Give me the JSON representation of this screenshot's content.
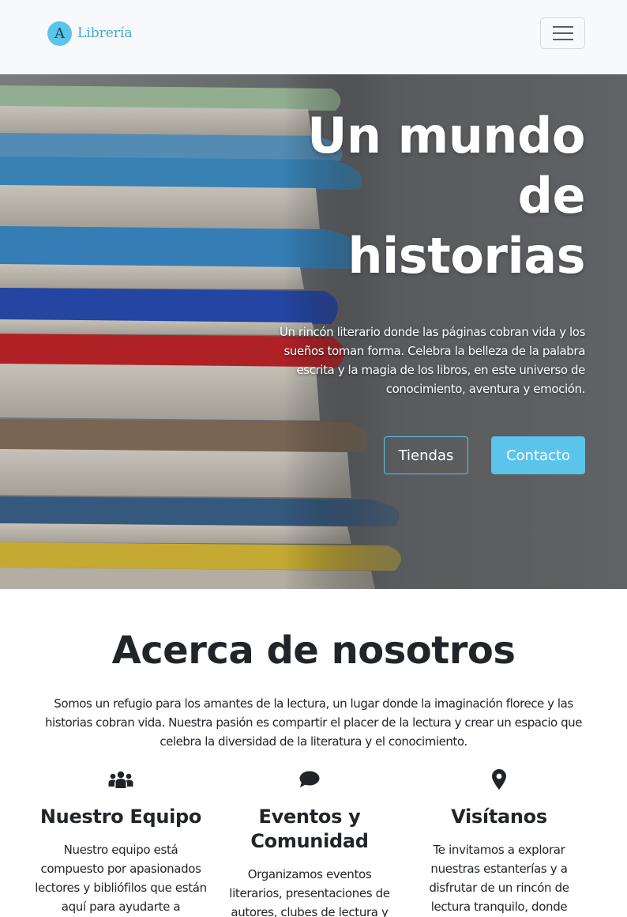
{
  "navbar": {
    "logo_letter": "A",
    "brand_text": "Librería",
    "brand_color": "#45a9cf",
    "menu_icon": "hamburger-icon"
  },
  "hero": {
    "title_line1": "Un mundo",
    "title_line2": "de",
    "title_line3": "historias",
    "subtitle": "Un rincón literario donde las páginas cobran vida y los sueños toman forma. Celebra la belleza de la palabra escrita y la magia de los libros, en este universo de conocimiento, aventura y emoción.",
    "buttons": {
      "stores_label": "Tiendas",
      "contact_label": "Contacto"
    },
    "accent_color": "#5bc4ea"
  },
  "about": {
    "title": "Acerca de nosotros",
    "text": "Somos un refugio para los amantes de la lectura, un lugar donde la imaginación florece y las historias cobran vida. Nuestra pasión es compartir el placer de la lectura y crear un espacio que celebra la diversidad de la literatura y el conocimiento.",
    "features": [
      {
        "icon": "people-icon",
        "title": "Nuestro Equipo",
        "text": "Nuestro equipo está compuesto por apasionados lectores y bibliófilos que están aquí para ayudarte a"
      },
      {
        "icon": "chat-bubble-icon",
        "title": "Eventos y Comunidad",
        "text": "Organizamos eventos literarios, presentaciones de autores, clubes de lectura y"
      },
      {
        "icon": "map-pin-icon",
        "title": "Visítanos",
        "text": "Te invitamos a explorar nuestras estanterías y a disfrutar de un rincón de lectura tranquilo, donde"
      }
    ]
  }
}
